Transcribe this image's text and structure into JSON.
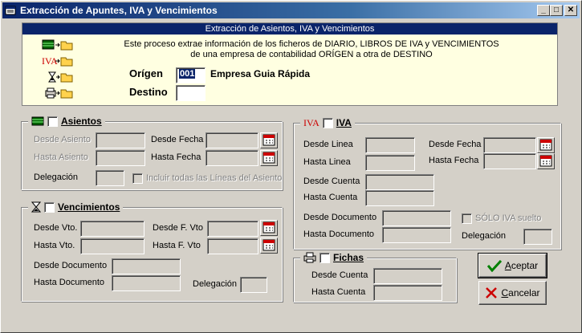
{
  "window": {
    "title": "Extracción de Apuntes, IVA y Vencimientos",
    "minimize": "_",
    "maximize": "□",
    "close": "✕"
  },
  "banner": {
    "title": "Extracción de Asientos, IVA y Vencimientos",
    "line1": "Este proceso extrae información de los ficheros de DIARIO, LIBROS DE IVA y VENCIMIENTOS",
    "line2": "de una empresa de  contabilidad ORÍGEN a otra de DESTINO",
    "origen_label": "Orígen",
    "origen_value": "001",
    "origen_name": "Empresa Guia Rápida",
    "destino_label": "Destino",
    "destino_value": "",
    "iva_logo": "IVA"
  },
  "asientos": {
    "title": "Asientos",
    "desde_asiento": "Desde Asiento",
    "hasta_asiento": "Hasta Asiento",
    "desde_fecha": "Desde Fecha",
    "hasta_fecha": "Hasta Fecha",
    "delegacion": "Delegación",
    "incluir": "Incluir todas las Líneas del Asiento"
  },
  "vencimientos": {
    "title": "Vencimientos",
    "desde_vto": "Desde Vto.",
    "hasta_vto": "Hasta Vto.",
    "desde_f_vto": "Desde F. Vto",
    "hasta_f_vto": "Hasta F. Vto",
    "desde_documento": "Desde Documento",
    "hasta_documento": "Hasta Documento",
    "delegacion": "Delegación"
  },
  "iva": {
    "title": "IVA",
    "logo": "IVA",
    "desde_linea": "Desde Linea",
    "hasta_linea": "Hasta Linea",
    "desde_fecha": "Desde Fecha",
    "hasta_fecha": "Hasta Fecha",
    "desde_cuenta": "Desde Cuenta",
    "hasta_cuenta": "Hasta Cuenta",
    "desde_documento": "Desde Documento",
    "hasta_documento": "Hasta Documento",
    "solo_iva": "SÓLO IVA suelto",
    "delegacion": "Delegación"
  },
  "fichas": {
    "title": "Fichas",
    "desde_cuenta": "Desde Cuenta",
    "hasta_cuenta": "Hasta Cuenta"
  },
  "buttons": {
    "aceptar_u": "A",
    "aceptar_rest": "ceptar",
    "cancelar_u": "C",
    "cancelar_rest": "ancelar"
  },
  "colors": {
    "title_start": "#0a246a",
    "banner_bg": "#ffffe1",
    "iva_red": "#cc0000",
    "check_green": "#008000",
    "cross_red": "#cc0000"
  }
}
